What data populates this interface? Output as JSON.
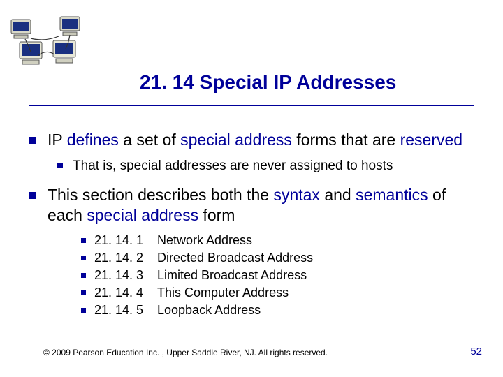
{
  "clipart": {
    "name": "networked-computers-icon"
  },
  "title": "21. 14  Special IP Addresses",
  "bullets": [
    {
      "text_plain": "IP defines a set of special address forms that are reserved",
      "segments": [
        {
          "t": "IP ",
          "c": "#000"
        },
        {
          "t": "defines",
          "c": "#000099"
        },
        {
          "t": " a set of ",
          "c": "#000"
        },
        {
          "t": "special address",
          "c": "#000099"
        },
        {
          "t": " forms that are ",
          "c": "#000"
        },
        {
          "t": "reserved",
          "c": "#000099"
        }
      ],
      "sub": [
        {
          "text": "That is, special addresses are never assigned to hosts"
        }
      ]
    },
    {
      "text_plain": "This section describes both the syntax and semantics of each special address form",
      "segments": [
        {
          "t": "This section describes both the ",
          "c": "#000"
        },
        {
          "t": "syntax",
          "c": "#000099"
        },
        {
          "t": " and ",
          "c": "#000"
        },
        {
          "t": "semantics",
          "c": "#000099"
        },
        {
          "t": " of each ",
          "c": "#000"
        },
        {
          "t": "special address",
          "c": "#000099"
        },
        {
          "t": " form",
          "c": "#000"
        }
      ],
      "list": [
        {
          "num": "21. 14. 1",
          "label": "Network Address"
        },
        {
          "num": "21. 14. 2",
          "label": "Directed Broadcast Address"
        },
        {
          "num": "21. 14. 3",
          "label": "Limited Broadcast Address"
        },
        {
          "num": "21. 14. 4",
          "label": "This Computer Address"
        },
        {
          "num": "21. 14. 5",
          "label": "Loopback Address"
        }
      ]
    }
  ],
  "footer": "© 2009 Pearson Education Inc. , Upper Saddle River, NJ. All rights reserved.",
  "page_number": "52"
}
